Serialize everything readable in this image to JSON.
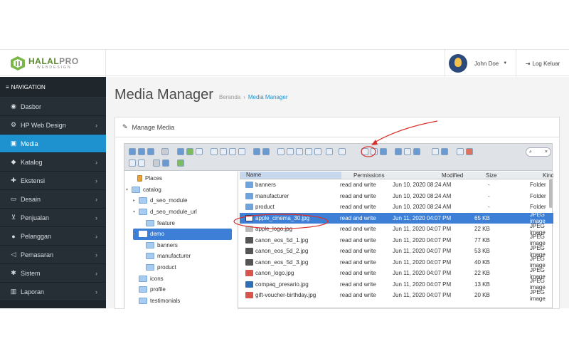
{
  "brand": {
    "name_a": "HALAL",
    "name_b": "PRO",
    "tagline": "WEBDESIGN"
  },
  "header": {
    "user_name": "John Doe",
    "logout_label": "Log Keluar"
  },
  "sidebar": {
    "heading": "NAVIGATION",
    "items": [
      {
        "label": "Dasbor",
        "icon": "dashboard-icon",
        "chevron": false
      },
      {
        "label": "HP Web Design",
        "icon": "cogs-icon",
        "chevron": true
      },
      {
        "label": "Media",
        "icon": "image-icon",
        "chevron": false,
        "active": true
      },
      {
        "label": "Katalog",
        "icon": "tag-icon",
        "chevron": true
      },
      {
        "label": "Ekstensi",
        "icon": "puzzle-icon",
        "chevron": true
      },
      {
        "label": "Desain",
        "icon": "monitor-icon",
        "chevron": true
      },
      {
        "label": "Penjualan",
        "icon": "cart-icon",
        "chevron": true
      },
      {
        "label": "Pelanggan",
        "icon": "user-icon",
        "chevron": true
      },
      {
        "label": "Pemasaran",
        "icon": "share-icon",
        "chevron": true
      },
      {
        "label": "Sistem",
        "icon": "gear-icon",
        "chevron": true
      },
      {
        "label": "Laporan",
        "icon": "bar-chart-icon",
        "chevron": true
      }
    ]
  },
  "page": {
    "title": "Media Manager",
    "breadcrumb_home": "Beranda",
    "breadcrumb_current": "Media Manager",
    "panel_title": "Manage Media"
  },
  "file_manager": {
    "search_clear": "×",
    "tree": [
      {
        "label": "Places",
        "depth": 0
      },
      {
        "label": "catalog",
        "depth": 0
      },
      {
        "label": "d_seo_module",
        "depth": 1
      },
      {
        "label": "d_seo_module_url",
        "depth": 1
      },
      {
        "label": "feature",
        "depth": 2
      },
      {
        "label": "demo",
        "depth": 1,
        "selected": true
      },
      {
        "label": "banners",
        "depth": 2
      },
      {
        "label": "manufacturer",
        "depth": 2
      },
      {
        "label": "product",
        "depth": 2
      },
      {
        "label": "icons",
        "depth": 1
      },
      {
        "label": "profile",
        "depth": 1
      },
      {
        "label": "testimonials",
        "depth": 1
      }
    ],
    "columns": {
      "name": "Name",
      "permissions": "Permissions",
      "modified": "Modified",
      "size": "Size",
      "kind": "Kind"
    },
    "files": [
      {
        "name": "banners",
        "perm": "read and write",
        "modified": "Jun 10, 2020 08:24 AM",
        "size": "-",
        "kind": "Folder",
        "icon": "folder2"
      },
      {
        "name": "manufacturer",
        "perm": "read and write",
        "modified": "Jun 10, 2020 08:24 AM",
        "size": "-",
        "kind": "Folder",
        "icon": "folder2"
      },
      {
        "name": "product",
        "perm": "read and write",
        "modified": "Jun 10, 2020 08:24 AM",
        "size": "-",
        "kind": "Folder",
        "icon": "folder2"
      },
      {
        "name": "apple_cinema_30.jpg",
        "perm": "read and write",
        "modified": "Jun 11, 2020 04:07 PM",
        "size": "65 KB",
        "kind": "JPEG image",
        "icon": "sel2",
        "selected": true
      },
      {
        "name": "apple_logo.jpg",
        "perm": "read and write",
        "modified": "Jun 11, 2020 04:07 PM",
        "size": "22 KB",
        "kind": "JPEG image",
        "icon": "img2"
      },
      {
        "name": "canon_eos_5d_1.jpg",
        "perm": "read and write",
        "modified": "Jun 11, 2020 04:07 PM",
        "size": "77 KB",
        "kind": "JPEG image",
        "icon": "img"
      },
      {
        "name": "canon_eos_5d_2.jpg",
        "perm": "read and write",
        "modified": "Jun 11, 2020 04:07 PM",
        "size": "53 KB",
        "kind": "JPEG image",
        "icon": "img"
      },
      {
        "name": "canon_eos_5d_3.jpg",
        "perm": "read and write",
        "modified": "Jun 11, 2020 04:07 PM",
        "size": "40 KB",
        "kind": "JPEG image",
        "icon": "img"
      },
      {
        "name": "canon_logo.jpg",
        "perm": "read and write",
        "modified": "Jun 11, 2020 04:07 PM",
        "size": "22 KB",
        "kind": "JPEG image",
        "icon": "red"
      },
      {
        "name": "compaq_presario.jpg",
        "perm": "read and write",
        "modified": "Jun 11, 2020 04:07 PM",
        "size": "13 KB",
        "kind": "JPEG image",
        "icon": "blue"
      },
      {
        "name": "gift-voucher-birthday.jpg",
        "perm": "read and write",
        "modified": "Jun 11, 2020 04:07 PM",
        "size": "20 KB",
        "kind": "JPEG image",
        "icon": "red"
      }
    ]
  },
  "colors": {
    "sidebar_bg": "#1f272d",
    "active": "#1e91cf",
    "selection": "#3d7fd6",
    "annotation": "#d9302a"
  }
}
